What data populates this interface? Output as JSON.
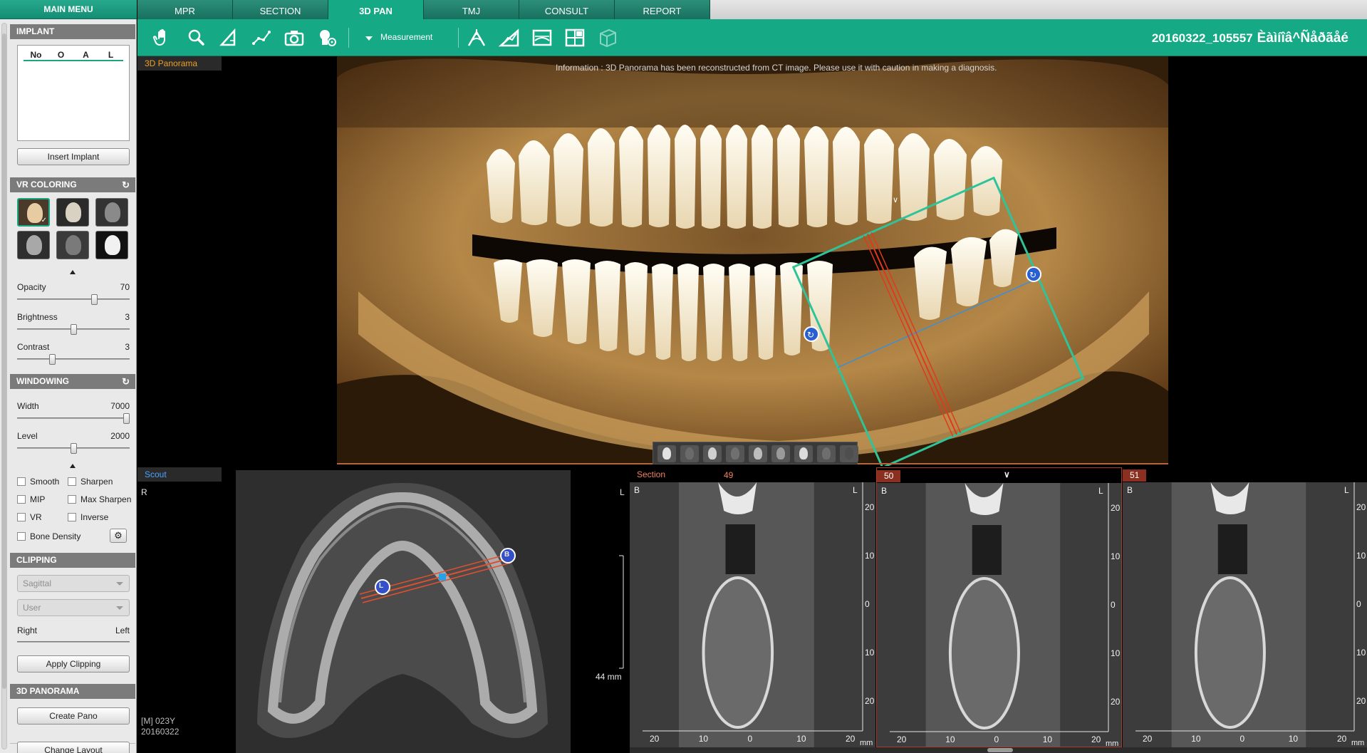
{
  "main_menu_label": "MAIN MENU",
  "tabs": [
    {
      "label": "MPR"
    },
    {
      "label": "SECTION"
    },
    {
      "label": "3D PAN"
    },
    {
      "label": "TMJ"
    },
    {
      "label": "CONSULT"
    },
    {
      "label": "REPORT"
    }
  ],
  "active_tab": "3D PAN",
  "toolbar": {
    "measurement_label": "Measurement",
    "patient_id": "20160322_105557",
    "patient_name": "Èàìíîâ^Ñåðãåé"
  },
  "sidebar": {
    "implant": {
      "header": "IMPLANT",
      "columns": [
        "No",
        "O",
        "A",
        "L"
      ],
      "insert_button": "Insert Implant"
    },
    "vr_coloring": {
      "header": "VR COLORING",
      "presets": [
        "color-skull-preset",
        "bone-preset",
        "gray-bone-preset",
        "skin-preset",
        "teeth-preset",
        "skull-mip-preset"
      ],
      "opacity": {
        "label": "Opacity",
        "value": "70",
        "level": 0.7
      },
      "brightness": {
        "label": "Brightness",
        "value": "3",
        "level": 0.5
      },
      "contrast": {
        "label": "Contrast",
        "value": "3",
        "level": 0.3
      }
    },
    "windowing": {
      "header": "WINDOWING",
      "width": {
        "label": "Width",
        "value": "7000",
        "level": 1.0
      },
      "level": {
        "label": "Level",
        "value": "2000",
        "level": 0.5
      },
      "checkboxes": {
        "smooth": "Smooth",
        "sharpen": "Sharpen",
        "mip": "MIP",
        "max_sharpen": "Max Sharpen",
        "vr": "VR",
        "inverse": "Inverse",
        "bone_density": "Bone Density"
      }
    },
    "clipping": {
      "header": "CLIPPING",
      "plane_select": "Sagittal",
      "mode_select": "User",
      "left_label": "Right",
      "right_label": "Left",
      "apply_button": "Apply Clipping"
    },
    "panorama": {
      "header": "3D PANORAMA",
      "create_button": "Create Pano",
      "layout_button": "Change Layout"
    }
  },
  "pano_view": {
    "title": "3D Panorama",
    "info": "Information : 3D Panorama has been reconstructed from CT image. Please use it with caution in making a diagnosis."
  },
  "scout_view": {
    "title": "Scout",
    "left_marker": "R",
    "right_marker": "L",
    "patient_line1": "[M] 023Y",
    "patient_line2": "20160322",
    "scale": "44 mm",
    "handle_l": "L",
    "handle_b": "B"
  },
  "section_views": [
    {
      "title": "Section",
      "number": "49",
      "left": "B",
      "right": "L"
    },
    {
      "title": "",
      "number": "50",
      "left": "B",
      "right": "L"
    },
    {
      "title": "",
      "number": "51",
      "left": "B",
      "right": "L"
    }
  ],
  "ruler": {
    "vertical": [
      "20",
      "10",
      "0",
      "10",
      "20"
    ],
    "horizontal": [
      "20",
      "10",
      "0",
      "10",
      "20"
    ],
    "unit": "mm"
  },
  "colors": {
    "accent": "#15aa85",
    "tab_dark": "#17705f",
    "section_red": "#8b2f20",
    "pano_title": "#f0a020",
    "scout_title": "#4aa3ff"
  }
}
